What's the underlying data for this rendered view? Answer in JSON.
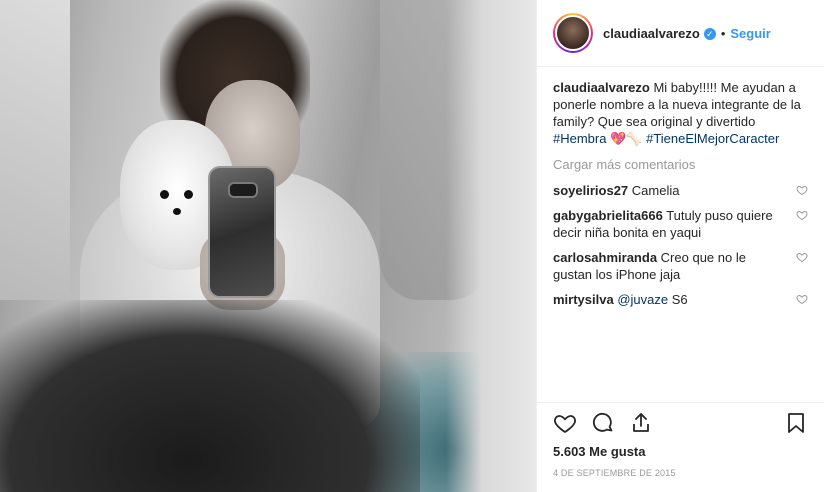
{
  "header": {
    "username": "claudiaalvarezo",
    "dot": "•",
    "follow_label": "Seguir"
  },
  "caption": {
    "username": "claudiaalvarezo",
    "text": "Mi baby!!!!! Me ayudan a ponerle nombre a la nueva integrante de la family? Que sea original y divertido ",
    "hashtag1": "#Hembra",
    "emojis": "💖🦴 ",
    "hashtag2": "#TieneElMejorCaracter"
  },
  "more_comments_label": "Cargar más comentarios",
  "comments": [
    {
      "username": "soyelirios27",
      "text": "Camelia"
    },
    {
      "username": "gabygabrielita666",
      "text": "Tutuly puso quiere decir niña bonita en yaqui"
    },
    {
      "username": "carlosahmiranda",
      "text": "Creo que no le gustan los iPhone jaja"
    },
    {
      "username": "mirtysilva",
      "mention": "@juvaze",
      "text": " S6"
    }
  ],
  "likes": "5.603 Me gusta",
  "date": "4 DE SEPTIEMBRE DE 2015",
  "colors": {
    "accent": "#3897f0",
    "hashtag": "#003569",
    "muted": "#999999"
  },
  "icons": [
    "verified-badge-icon",
    "heart-icon",
    "comment-icon",
    "share-icon",
    "bookmark-icon",
    "small-heart-icon"
  ]
}
